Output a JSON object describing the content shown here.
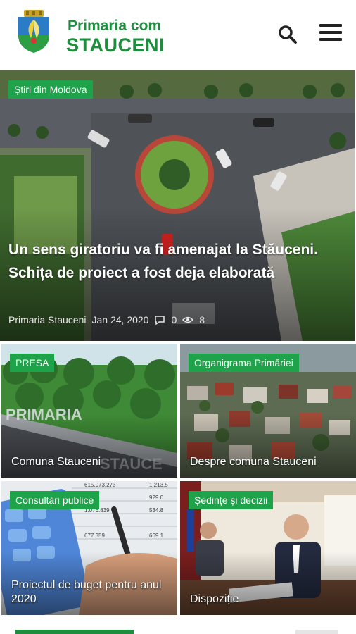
{
  "header": {
    "logo_line1": "Primaria com",
    "logo_line2": "STAUCENI",
    "brand_color": "#1e8e3e",
    "search_icon": "search-icon",
    "menu_icon": "hamburger-menu-icon"
  },
  "hero": {
    "category": "Știri din Moldova",
    "title": "Un sens giratoriu va fi amenajat la Stăuceni. Schița de proiect a fost deja elaborată",
    "author": "Primaria Stauceni",
    "date": "Jan 24, 2020",
    "comments": "0",
    "views": "8",
    "badge_color": "#1fa34a"
  },
  "tiles": [
    {
      "category": "PRESA",
      "title": "Comuna Stauceni"
    },
    {
      "category": "Organigrama Primăriei",
      "title": "Despre comuna Stauceni"
    },
    {
      "category": "Consultări publice",
      "title": "Proiectul de buget pentru anul 2020"
    },
    {
      "category": "Ședințe și decizii",
      "title": "Dispoziție"
    }
  ]
}
